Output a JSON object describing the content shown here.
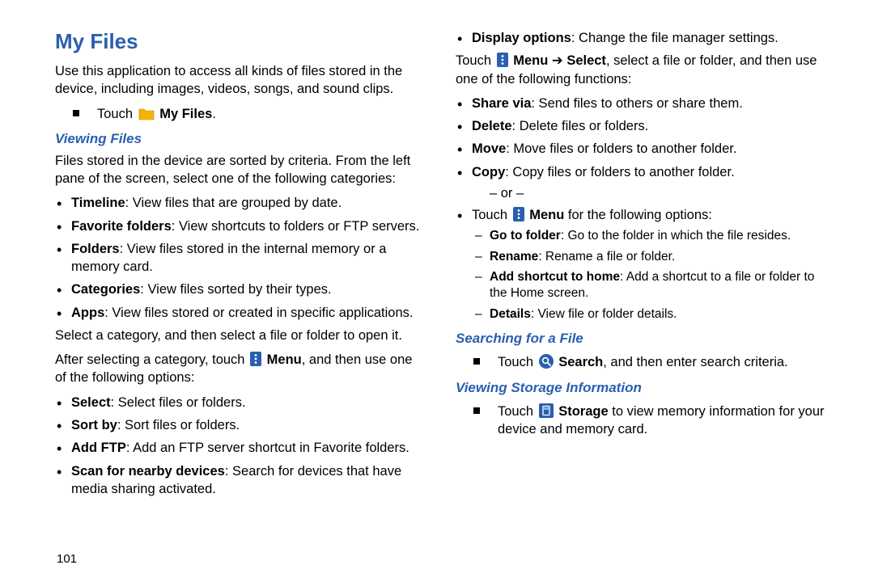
{
  "title": "My Files",
  "intro": "Use this application to access all kinds of files stored in the device, including images, videos, songs, and sound clips.",
  "touch_myfiles_prefix": "Touch ",
  "touch_myfiles_label": "My Files",
  "period": ".",
  "viewing_files_heading": "Viewing Files",
  "viewing_files_intro": "Files stored in the device are sorted by criteria. From the left pane of the screen, select one of the following categories:",
  "categories": [
    {
      "term": "Timeline",
      "desc": ": View files that are grouped by date."
    },
    {
      "term": "Favorite folders",
      "desc": ": View shortcuts to folders or FTP servers."
    },
    {
      "term": "Folders",
      "desc": ": View files stored in the internal memory or a memory card."
    },
    {
      "term": "Categories",
      "desc": ": View files sorted by their types."
    },
    {
      "term": "Apps",
      "desc": ": View files stored or created in specific applications."
    }
  ],
  "select_category_line": "Select a category, and then select a file or folder to open it.",
  "after_selecting_prefix": "After selecting a category, touch ",
  "menu_label": "Menu",
  "after_selecting_suffix": ", and then use one of the following options:",
  "options1": [
    {
      "term": "Select",
      "desc": ": Select files or folders."
    },
    {
      "term": "Sort by",
      "desc": ": Sort files or folders."
    },
    {
      "term": "Add FTP",
      "desc": ": Add an FTP server shortcut in Favorite folders."
    },
    {
      "term": "Scan for nearby devices",
      "desc": ": Search for devices that have media sharing activated."
    },
    {
      "term": "Display options",
      "desc": ": Change the file manager settings."
    }
  ],
  "menu_select_prefix": "Touch ",
  "menu_select_mid1": "Menu",
  "menu_select_arrow": " ➔ ",
  "menu_select_mid2": "Select",
  "menu_select_suffix": ", select a file or folder, and then use one of the following functions:",
  "options2": [
    {
      "term": "Share via",
      "desc": ": Send files to others or share them."
    },
    {
      "term": "Delete",
      "desc": ": Delete files or folders."
    },
    {
      "term": "Move",
      "desc": ": Move files or folders to another folder."
    },
    {
      "term": "Copy",
      "desc": ": Copy files or folders to another folder."
    }
  ],
  "or_text": "– or –",
  "touch_menu_following_prefix": "Touch ",
  "touch_menu_following_suffix": " for the following options:",
  "sub_options": [
    {
      "term": "Go to folder",
      "desc": ": Go to the folder in which the file resides."
    },
    {
      "term": "Rename",
      "desc": ": Rename a file or folder."
    },
    {
      "term": "Add shortcut to home",
      "desc": ": Add a shortcut to a file or folder to the Home screen."
    },
    {
      "term": "Details",
      "desc": ": View file or folder details."
    }
  ],
  "searching_heading": "Searching for a File",
  "search_prefix": "Touch ",
  "search_label": "Search",
  "search_suffix": ", and then enter search criteria.",
  "storage_heading": "Viewing Storage Information",
  "storage_prefix": "Touch ",
  "storage_label": "Storage",
  "storage_suffix": " to view memory information for your device and memory card.",
  "page_number": "101"
}
